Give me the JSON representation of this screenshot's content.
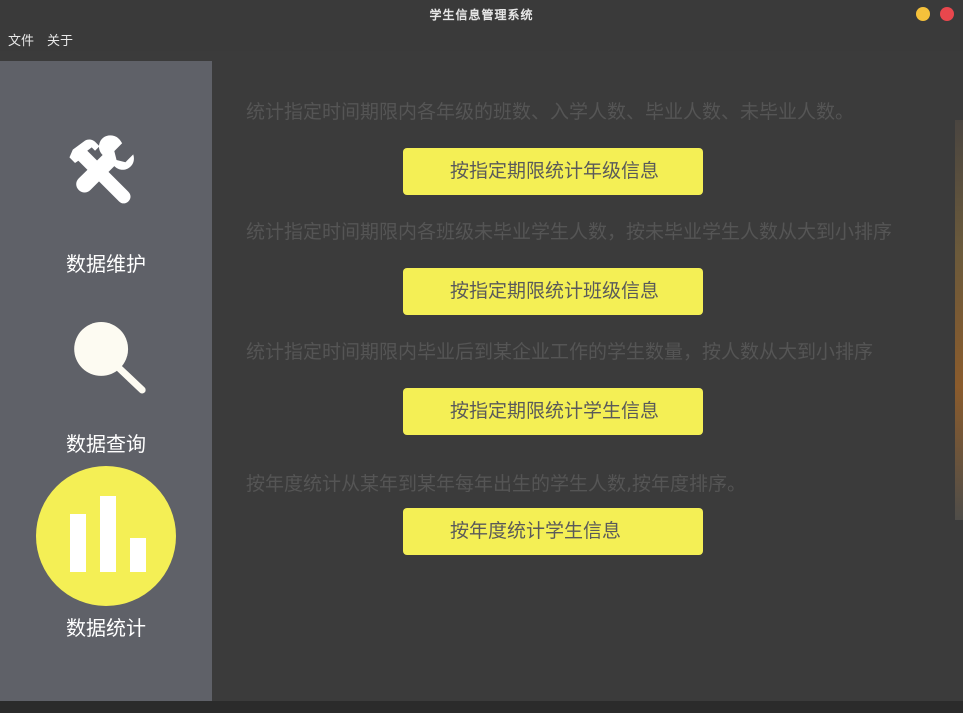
{
  "window": {
    "title": "学生信息管理系统"
  },
  "menubar": {
    "file": "文件",
    "about": "关于"
  },
  "sidebar": {
    "items": [
      {
        "label": "数据维护",
        "icon": "tools-icon"
      },
      {
        "label": "数据查询",
        "icon": "search-icon"
      },
      {
        "label": "数据统计",
        "icon": "bar-chart-icon",
        "active": true
      }
    ],
    "active_color": "#f4ef55"
  },
  "main": {
    "sections": [
      {
        "description": "统计指定时间期限内各年级的班数、入学人数、毕业人数、未毕业人数。",
        "button": "按指定期限统计年级信息"
      },
      {
        "description": "统计指定时间期限内各班级未毕业学生人数，按未毕业学生人数从大到小排序",
        "button": "按指定期限统计班级信息"
      },
      {
        "description": "统计指定时间期限内毕业后到某企业工作的学生数量，按人数从大到小排序",
        "button": "按指定期限统计学生信息"
      },
      {
        "description": "按年度统计从某年到某年每年出生的学生人数,按年度排序。",
        "button": "按年度统计学生信息"
      }
    ],
    "button_color": "#f4ef55"
  }
}
